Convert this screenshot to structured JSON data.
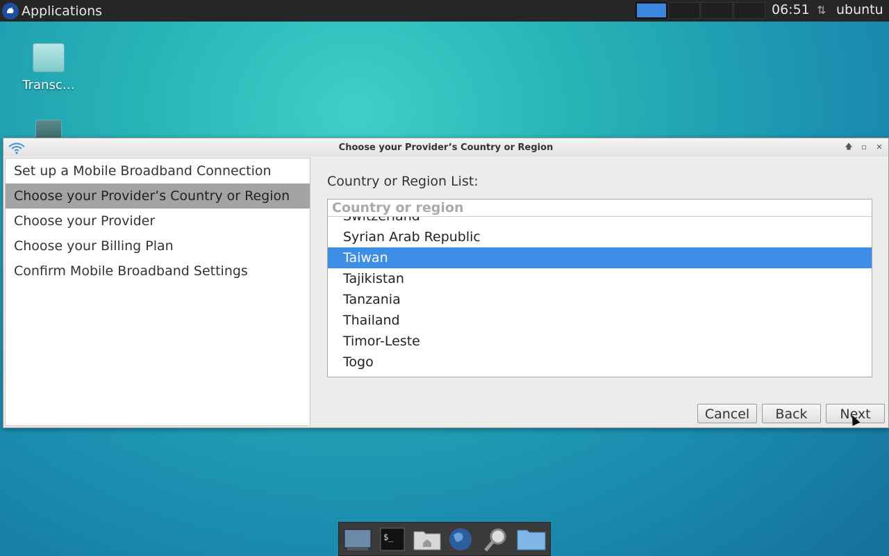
{
  "top_panel": {
    "applications_label": "Applications",
    "clock": "06:51",
    "user": "ubuntu",
    "network_icon": "network-updown-icon"
  },
  "desktop": {
    "icons": [
      {
        "label": "Transc…",
        "icon": "usb-drive-icon"
      },
      {
        "label": "",
        "icon": "sd-card-icon"
      }
    ]
  },
  "dialog": {
    "title": "Choose your Provider’s Country or Region",
    "steps": [
      {
        "label": "Set up a Mobile Broadband Connection"
      },
      {
        "label": "Choose your Provider’s Country or Region"
      },
      {
        "label": "Choose your Provider"
      },
      {
        "label": "Choose your Billing Plan"
      },
      {
        "label": "Confirm Mobile Broadband Settings"
      }
    ],
    "current_step_index": 1,
    "list_label": "Country or Region List:",
    "search_placeholder": "Country or region",
    "countries": [
      "Switzerland",
      "Syrian Arab Republic",
      "Taiwan",
      "Tajikistan",
      "Tanzania",
      "Thailand",
      "Timor-Leste",
      "Togo"
    ],
    "selected_country": "Taiwan",
    "buttons": {
      "cancel": "Cancel",
      "back": "Back",
      "next": "Next"
    }
  },
  "dock": {
    "items": [
      {
        "name": "show-desktop-icon"
      },
      {
        "name": "terminal-icon"
      },
      {
        "name": "home-folder-icon"
      },
      {
        "name": "web-browser-icon"
      },
      {
        "name": "search-icon"
      },
      {
        "name": "file-manager-icon"
      }
    ]
  }
}
